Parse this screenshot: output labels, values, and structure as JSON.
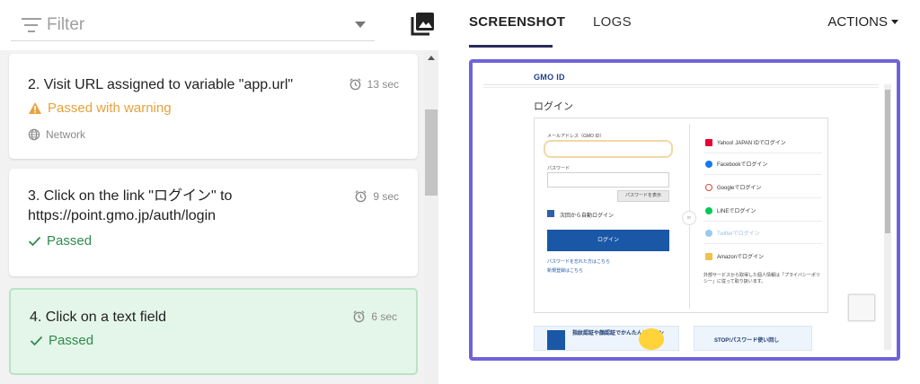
{
  "filter": {
    "placeholder": "Filter"
  },
  "steps": [
    {
      "title": "2. Visit URL assigned to variable \"app.url\"",
      "time": "13 sec",
      "status": "Passed with warning",
      "meta": "Network"
    },
    {
      "title_line1": "3. Click on the link \"ログイン\" to",
      "title_line2": "https://point.gmo.jp/auth/login",
      "time": "9 sec",
      "status": "Passed"
    },
    {
      "title": "4. Click on a text field",
      "time": "6 sec",
      "status": "Passed"
    }
  ],
  "tabs": {
    "screenshot": "SCREENSHOT",
    "logs": "LOGS",
    "actions": "ACTIONS"
  },
  "shot": {
    "logo": "GMO ID",
    "title": "ログイン",
    "email_label": "メールアドレス（GMO ID）",
    "password_label": "パスワード",
    "show_password": "パスワードを表示",
    "remember": "次回から自動ログイン",
    "login_button": "ログイン",
    "forgot": "パスワードを忘れた方はこちら",
    "register": "新規登録はこちら",
    "or": "or",
    "socials": [
      "Yahoo! JAPAN IDでログイン",
      "Facebookでログイン",
      "Googleでログイン",
      "LINEでログイン",
      "Twitterでログイン",
      "Amazonでログイン"
    ],
    "notice": "外部サービスから取得した個人情報は「プライバシーポリシー」に従って取り扱います。",
    "banner1": "指紋認証や顔認証でかんたんログイン",
    "banner2": "STOP!パスワード使い回し"
  },
  "colors": {
    "frame": "#6f63d9",
    "pass": "#2e8b4e",
    "warn": "#e6a23c",
    "active_bg": "#e4f5e9",
    "gmo_blue": "#1a57a6"
  }
}
